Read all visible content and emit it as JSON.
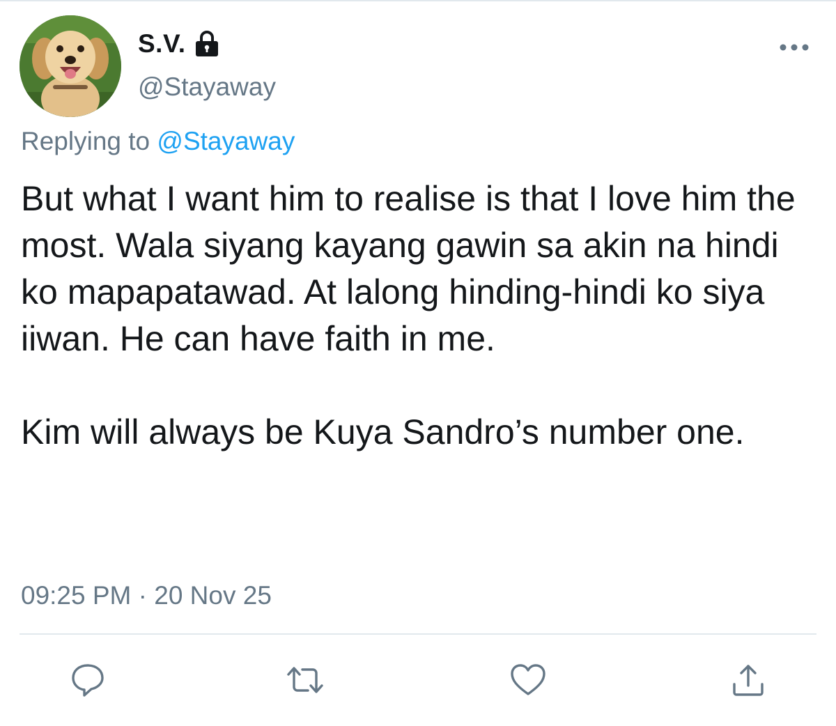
{
  "tweet": {
    "display_name": "S.V.",
    "handle": "@Stayaway",
    "protected_icon": "lock-icon",
    "more_icon": "more-options-icon",
    "replying_label": "Replying to",
    "replying_handle": "@Stayaway",
    "text_paragraph_1": "But what I want him to realise is that I love him the most. Wala siyang kayang gawin sa akin na hindi ko mapapatawad. At lalong hinding-hindi ko siya iiwan. He can have faith in me.",
    "text_paragraph_2": "Kim will always be Kuya Sandro’s number one.",
    "timestamp": "09:25 PM · 20 Nov 25"
  },
  "actions": [
    {
      "name": "reply",
      "icon": "comment-icon"
    },
    {
      "name": "retweet",
      "icon": "retweet-icon"
    },
    {
      "name": "like",
      "icon": "heart-icon"
    },
    {
      "name": "share",
      "icon": "share-icon"
    }
  ],
  "colors": {
    "text": "#14171a",
    "secondary": "#657786",
    "link": "#1da1f2",
    "divider": "#e1e8ed"
  }
}
